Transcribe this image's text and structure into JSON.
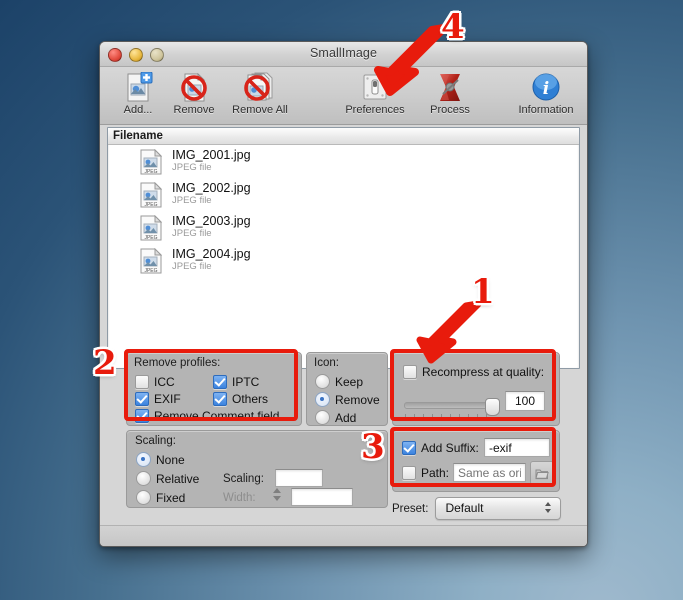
{
  "window": {
    "title": "SmallImage",
    "traffic_lights": [
      "close-button",
      "minimize-button",
      "zoom-button"
    ]
  },
  "toolbar": {
    "items": [
      {
        "label": "Add...",
        "icon": "add-file-icon"
      },
      {
        "label": "Remove",
        "icon": "remove-file-icon"
      },
      {
        "label": "Remove All",
        "icon": "remove-all-files-icon"
      },
      {
        "label": "Preferences",
        "icon": "preferences-icon"
      },
      {
        "label": "Process",
        "icon": "process-icon"
      },
      {
        "label": "Information",
        "icon": "information-icon"
      }
    ]
  },
  "file_list": {
    "column_header": "Filename",
    "rows": [
      {
        "name": "IMG_2001.jpg",
        "kind": "JPEG file",
        "icon": "jpeg-file-icon"
      },
      {
        "name": "IMG_2002.jpg",
        "kind": "JPEG file",
        "icon": "jpeg-file-icon"
      },
      {
        "name": "IMG_2003.jpg",
        "kind": "JPEG file",
        "icon": "jpeg-file-icon"
      },
      {
        "name": "IMG_2004.jpg",
        "kind": "JPEG file",
        "icon": "jpeg-file-icon"
      }
    ]
  },
  "remove_profiles": {
    "title": "Remove profiles:",
    "checkboxes": [
      {
        "label": "ICC",
        "checked": false
      },
      {
        "label": "IPTC",
        "checked": true
      },
      {
        "label": "EXIF",
        "checked": true
      },
      {
        "label": "Others",
        "checked": true
      },
      {
        "label": "Remove Comment field",
        "checked": true
      }
    ]
  },
  "icon_group": {
    "title": "Icon:",
    "options": [
      {
        "label": "Keep",
        "selected": false
      },
      {
        "label": "Remove",
        "selected": true
      },
      {
        "label": "Add",
        "selected": false
      }
    ]
  },
  "recompress": {
    "label": "Recompress at quality:",
    "checked": false,
    "quality_value": "100",
    "slider_percent": 100
  },
  "scaling": {
    "title": "Scaling:",
    "options": [
      {
        "label": "None",
        "selected": true
      },
      {
        "label": "Relative",
        "selected": false
      },
      {
        "label": "Fixed",
        "selected": false
      }
    ],
    "scaling_label": "Scaling:",
    "scaling_value": "",
    "width_label": "Width:",
    "width_value": "",
    "width_disabled": true
  },
  "output": {
    "suffix_label": "Add Suffix:",
    "suffix_checked": true,
    "suffix_value": "-exif",
    "path_label": "Path:",
    "path_checked": false,
    "path_placeholder": "Same as orig",
    "browse_icon": "folder-icon"
  },
  "preset": {
    "label": "Preset:",
    "value": "Default"
  },
  "annotations": {
    "markers": [
      {
        "number": "1",
        "target": "recompress-at-quality-checkbox"
      },
      {
        "number": "2",
        "target": "remove-profiles-group"
      },
      {
        "number": "3",
        "target": "output-suffix-group"
      },
      {
        "number": "4",
        "target": "process-toolbar-button"
      }
    ],
    "color": "#e81b0c"
  }
}
